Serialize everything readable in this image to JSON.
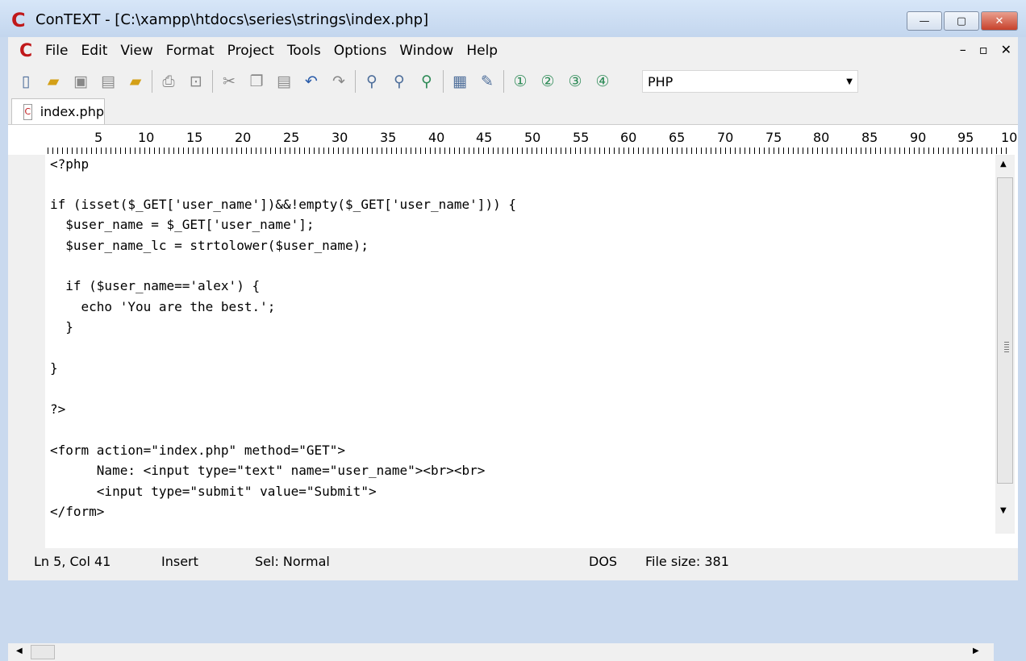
{
  "window": {
    "logo": "C",
    "title": "ConTEXT - [C:\\xampp\\htdocs\\series\\strings\\index.php]",
    "minimize_icon": "minimize-icon",
    "maximize_icon": "maximize-icon",
    "close_icon": "close-icon"
  },
  "menu": {
    "logo": "C",
    "items": [
      "File",
      "Edit",
      "View",
      "Format",
      "Project",
      "Tools",
      "Options",
      "Window",
      "Help"
    ],
    "mdi_buttons": [
      "–",
      "▫",
      "✕"
    ]
  },
  "toolbar": {
    "icons": [
      "new-file-icon",
      "open-icon",
      "save-icon",
      "save-all-icon",
      "open-folder-icon",
      "print-icon",
      "print-preview-icon",
      "cut-icon",
      "copy-icon",
      "paste-icon",
      "undo-icon",
      "redo-icon",
      "find-icon",
      "find-next-icon",
      "replace-icon",
      "properties-icon",
      "tools-icon",
      "user-command-1-icon",
      "user-command-2-icon",
      "user-command-3-icon",
      "user-command-4-icon"
    ],
    "language": "PHP"
  },
  "tabs": [
    {
      "label": "index.php"
    }
  ],
  "ruler": {
    "numbers": [
      "5",
      "10",
      "15",
      "20",
      "25",
      "30",
      "35",
      "40",
      "45",
      "50",
      "55",
      "60",
      "65",
      "70",
      "75",
      "80",
      "85",
      "90",
      "95",
      "10"
    ]
  },
  "code_lines": [
    "<?php",
    "",
    "if (isset($_GET['user_name'])&&!empty($_GET['user_name'])) {",
    "  $user_name = $_GET['user_name'];",
    "  $user_name_lc = strtolower($user_name);",
    "",
    "  if ($user_name=='alex') {",
    "    echo 'You are the best.';",
    "  }",
    "",
    "}",
    "",
    "?>",
    "",
    "<form action=\"index.php\" method=\"GET\">",
    "      Name: <input type=\"text\" name=\"user_name\"><br><br>",
    "      <input type=\"submit\" value=\"Submit\">",
    "</form>"
  ],
  "status": {
    "position": "Ln 5, Col 41",
    "mode": "Insert",
    "selection": "Sel: Normal",
    "line_endings": "DOS",
    "file_size": "File size: 381"
  }
}
